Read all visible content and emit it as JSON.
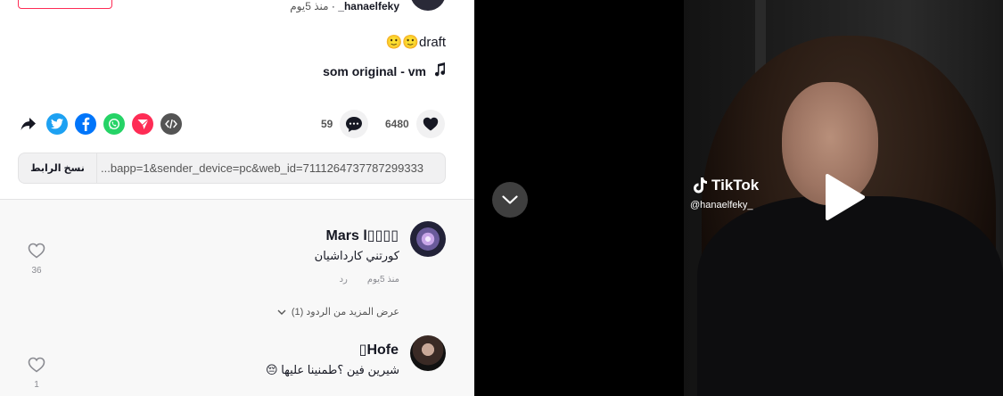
{
  "author": {
    "username": "hanaelfeky_",
    "separator": "·",
    "posted_time": "منذ 5يوم"
  },
  "video": {
    "caption": "draft",
    "caption_emojis": "🙂🙂",
    "music": "som original - vm",
    "likes": "6480",
    "comments": "59",
    "share_link": "...bapp=1&sender_device=pc&web_id=7111264737787299333",
    "copy_link_label": "نسخ الرابط"
  },
  "share_icons": [
    "embed-icon",
    "telegram-icon",
    "whatsapp-icon",
    "facebook-icon",
    "twitter-icon",
    "share-arrow-icon"
  ],
  "comments": [
    {
      "name": "Mars l▯▯▯▯",
      "text": "كورتني كارداشيان",
      "time": "منذ 5يوم",
      "reply_label": "رد",
      "likes": "36",
      "more_replies": "عرض المزيد من الردود (1)"
    },
    {
      "name": "▯Hofe",
      "text": "شيرين فين ؟طمنينا عليها 😔",
      "likes": "1"
    }
  ],
  "overlay": {
    "brand": "TikTok",
    "handle": "@hanaelfeky_"
  },
  "colors": {
    "accent": "#fe2c55",
    "twitter": "#1da1f2",
    "facebook": "#0075fa",
    "whatsapp": "#25d366",
    "telegram": "#fe2c55",
    "embed": "#545454"
  }
}
